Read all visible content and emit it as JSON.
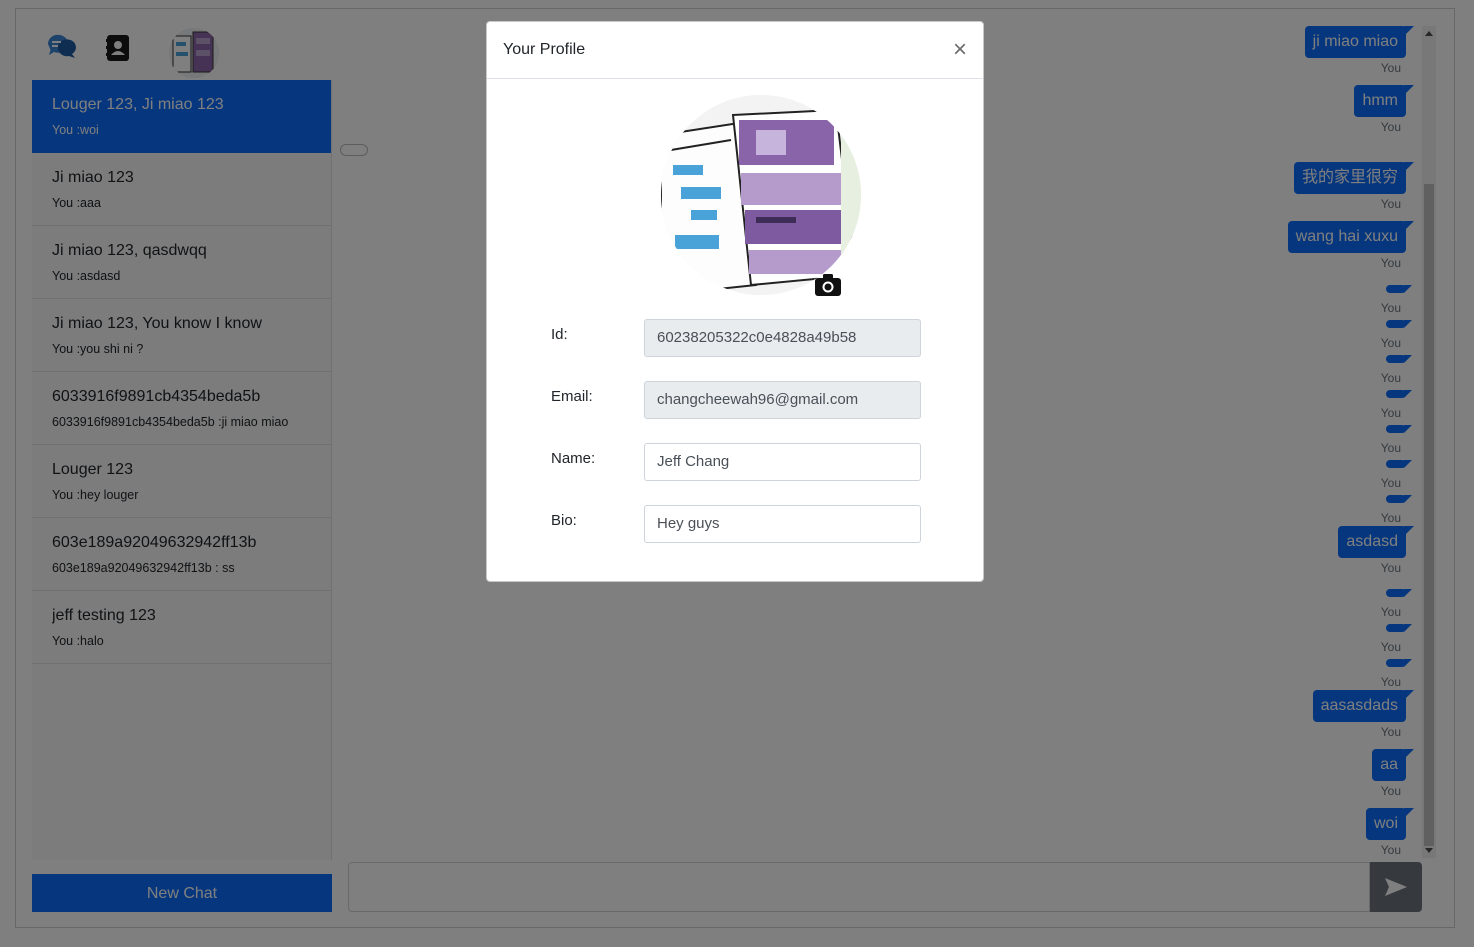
{
  "modal": {
    "title": "Your Profile",
    "close_label": "×",
    "fields": {
      "id": {
        "label": "Id:",
        "value": "60238205322c0e4828a49b58"
      },
      "email": {
        "label": "Email:",
        "value": "changcheewah96@gmail.com"
      },
      "name": {
        "label": "Name:",
        "value": "Jeff Chang"
      },
      "bio": {
        "label": "Bio:",
        "value": "Hey guys"
      }
    }
  },
  "sidebar": {
    "icons": [
      "chat-bubbles-icon",
      "contact-book-icon",
      "user-avatar"
    ],
    "conversations": [
      {
        "name": "Louger 123, Ji miao 123",
        "last": "You :woi",
        "active": true
      },
      {
        "name": "Ji miao 123",
        "last": "You :aaa"
      },
      {
        "name": "Ji miao 123, qasdwqq",
        "last": "You :asdasd"
      },
      {
        "name": "Ji miao 123, You know I know",
        "last": "You :you shi ni ?"
      },
      {
        "name": "6033916f9891cb4354beda5b",
        "last": "6033916f9891cb4354beda5b :ji miao miao"
      },
      {
        "name": "Louger 123",
        "last": "You :hey louger"
      },
      {
        "name": "603e189a92049632942ff13b",
        "last": "603e189a92049632942ff13b : ss"
      },
      {
        "name": "jeff testing 123",
        "last": "You :halo"
      }
    ],
    "new_chat_label": "New Chat"
  },
  "chat": {
    "sender_label": "You",
    "messages": [
      "ji miao miao",
      "hmm",
      "",
      "我的家里很穷",
      "wang hai xuxu",
      "",
      "",
      "",
      "",
      "",
      "",
      "",
      "asdasd",
      "",
      "",
      "",
      "aasasdads",
      "aa",
      "woi"
    ],
    "composer_value": "",
    "send_icon": "send-arrow-icon"
  }
}
